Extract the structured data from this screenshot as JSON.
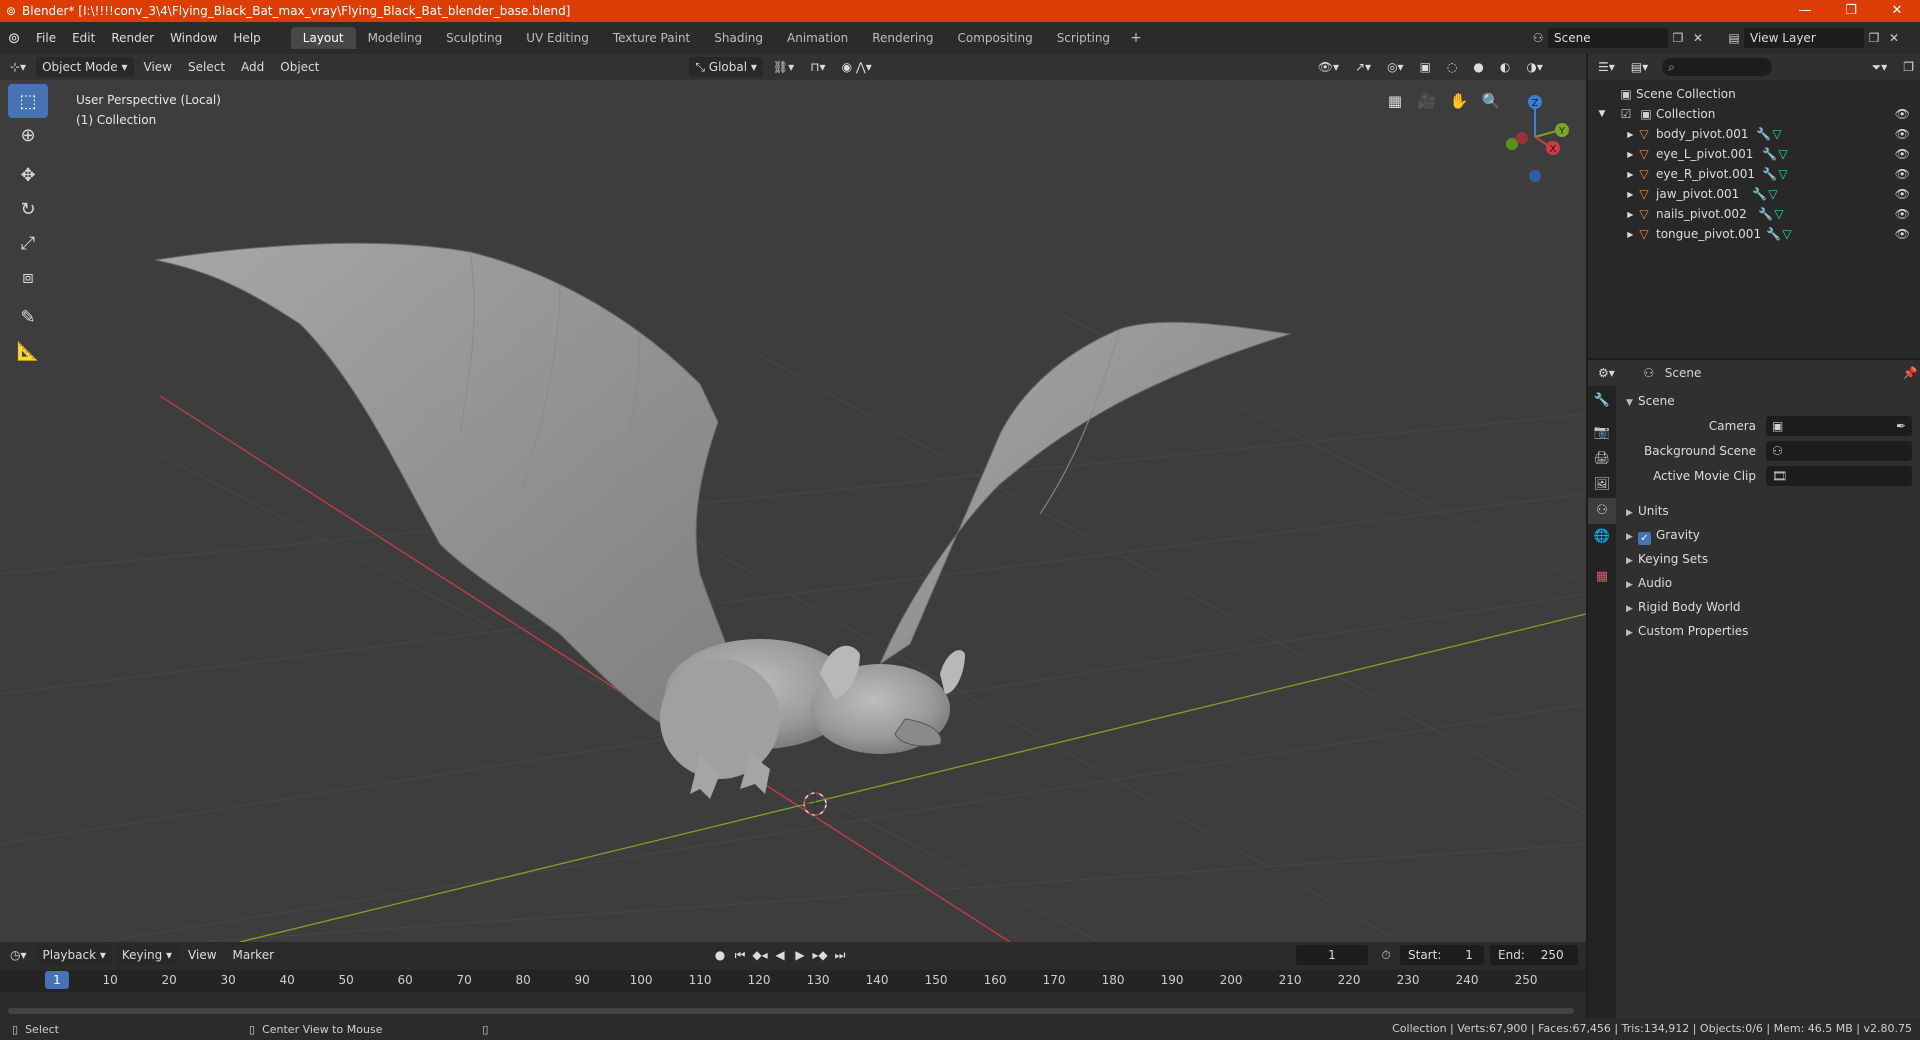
{
  "window": {
    "title": "Blender* [I:\\!!!!conv_3\\4\\Flying_Black_Bat_max_vray\\Flying_Black_Bat_blender_base.blend]",
    "minimize": "—",
    "maximize": "❐",
    "close": "✕"
  },
  "menu": {
    "file": "File",
    "edit": "Edit",
    "render": "Render",
    "window": "Window",
    "help": "Help"
  },
  "workspaces": [
    {
      "label": "Layout",
      "active": true
    },
    {
      "label": "Modeling"
    },
    {
      "label": "Sculpting"
    },
    {
      "label": "UV Editing"
    },
    {
      "label": "Texture Paint"
    },
    {
      "label": "Shading"
    },
    {
      "label": "Animation"
    },
    {
      "label": "Rendering"
    },
    {
      "label": "Compositing"
    },
    {
      "label": "Scripting"
    }
  ],
  "scene_selector": {
    "value": "Scene"
  },
  "view_layer_selector": {
    "value": "View Layer"
  },
  "viewport": {
    "mode": "Object Mode",
    "menus": {
      "view": "View",
      "select": "Select",
      "add": "Add",
      "object": "Object"
    },
    "transform_orientation": "Global",
    "info_line1": "User Perspective (Local)",
    "info_line2": "(1) Collection",
    "axis_labels": {
      "x": "X",
      "y": "Y",
      "z": "Z"
    }
  },
  "timeline": {
    "menus": {
      "playback": "Playback",
      "keying": "Keying",
      "view": "View",
      "marker": "Marker"
    },
    "current_frame": "1",
    "start_label": "Start:",
    "start_value": "1",
    "end_label": "End:",
    "end_value": "250",
    "ticks": [
      "1",
      "10",
      "20",
      "30",
      "40",
      "50",
      "60",
      "70",
      "80",
      "90",
      "100",
      "110",
      "120",
      "130",
      "140",
      "150",
      "160",
      "170",
      "180",
      "190",
      "200",
      "210",
      "220",
      "230",
      "240",
      "250"
    ]
  },
  "statusbar": {
    "select_hint": "Select",
    "center_hint": "Center View to Mouse",
    "stats": "Collection | Verts:67,900 | Faces:67,456 | Tris:134,912 | Objects:0/6 | Mem: 46.5 MB | v2.80.75"
  },
  "outliner": {
    "root": "Scene Collection",
    "collection": "Collection",
    "objects": [
      "body_pivot.001",
      "eye_L_pivot.001",
      "eye_R_pivot.001",
      "jaw_pivot.001",
      "nails_pivot.002",
      "tongue_pivot.001"
    ]
  },
  "properties": {
    "context": "Scene",
    "panel_title": "Scene",
    "camera_label": "Camera",
    "background_scene_label": "Background Scene",
    "active_movie_clip_label": "Active Movie Clip",
    "sections": {
      "units": "Units",
      "gravity": "Gravity",
      "keying_sets": "Keying Sets",
      "audio": "Audio",
      "rigid_body_world": "Rigid Body World",
      "custom_properties": "Custom Properties"
    },
    "gravity_enabled": true
  },
  "colors": {
    "titlebar": "#dc3d05",
    "accent": "#4772b3",
    "x_axis": "#c83c46",
    "y_axis": "#7ba428",
    "z_axis": "#3d7fd6"
  }
}
